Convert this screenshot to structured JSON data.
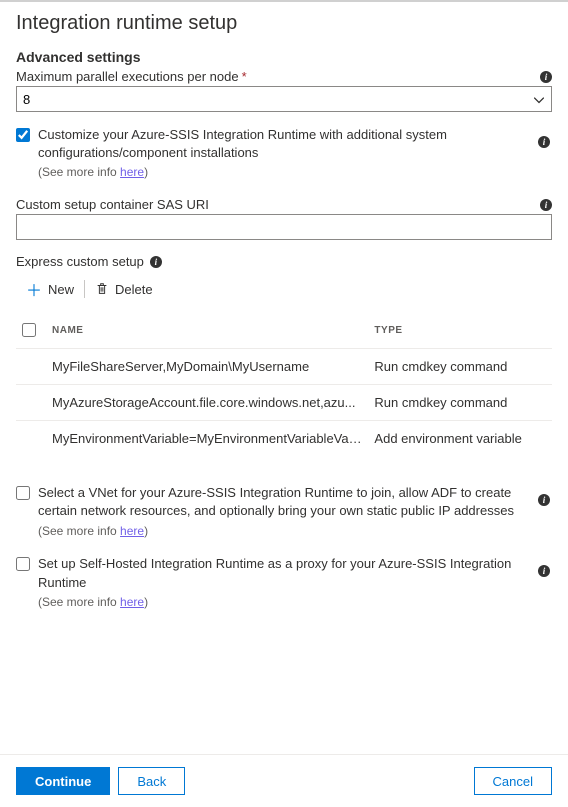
{
  "title": "Integration runtime setup",
  "section": "Advanced settings",
  "maxParallel": {
    "label": "Maximum parallel executions per node",
    "value": "8"
  },
  "customize": {
    "label": "Customize your Azure-SSIS Integration Runtime with additional system configurations/component installations",
    "moreInfoPrefix": "(See more info ",
    "moreInfoLink": "here",
    "moreInfoSuffix": ")"
  },
  "sasUri": {
    "label": "Custom setup container SAS URI",
    "value": ""
  },
  "express": {
    "label": "Express custom setup",
    "newBtn": "New",
    "deleteBtn": "Delete",
    "columns": {
      "name": "NAME",
      "type": "TYPE"
    },
    "rows": [
      {
        "name": "MyFileShareServer,MyDomain\\MyUsername",
        "type": "Run cmdkey command"
      },
      {
        "name": "MyAzureStorageAccount.file.core.windows.net,azu...",
        "type": "Run cmdkey command"
      },
      {
        "name": "MyEnvironmentVariable=MyEnvironmentVariableValu...",
        "type": "Add environment variable"
      }
    ]
  },
  "vnet": {
    "label": "Select a VNet for your Azure-SSIS Integration Runtime to join, allow ADF to create certain network resources, and optionally bring your own static public IP addresses",
    "moreInfoPrefix": "(See more info ",
    "moreInfoLink": "here",
    "moreInfoSuffix": ")"
  },
  "proxy": {
    "label": "Set up Self-Hosted Integration Runtime as a proxy for your Azure-SSIS Integration Runtime",
    "moreInfoPrefix": "(See more info ",
    "moreInfoLink": "here",
    "moreInfoSuffix": ")"
  },
  "footer": {
    "continue": "Continue",
    "back": "Back",
    "cancel": "Cancel"
  }
}
